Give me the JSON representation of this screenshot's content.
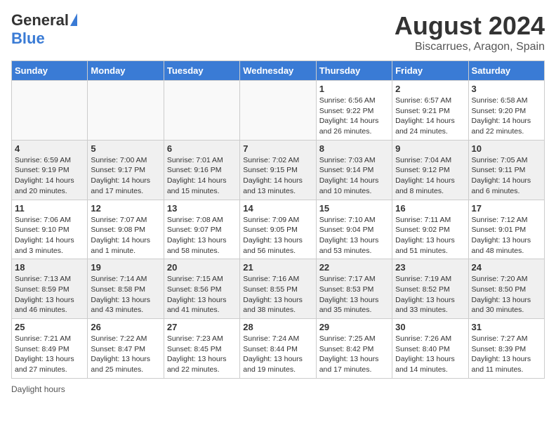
{
  "header": {
    "logo_line1": "General",
    "logo_line2": "Blue",
    "title": "August 2024",
    "subtitle": "Biscarrues, Aragon, Spain"
  },
  "calendar": {
    "days_of_week": [
      "Sunday",
      "Monday",
      "Tuesday",
      "Wednesday",
      "Thursday",
      "Friday",
      "Saturday"
    ],
    "weeks": [
      [
        {
          "day": "",
          "info": ""
        },
        {
          "day": "",
          "info": ""
        },
        {
          "day": "",
          "info": ""
        },
        {
          "day": "",
          "info": ""
        },
        {
          "day": "1",
          "info": "Sunrise: 6:56 AM\nSunset: 9:22 PM\nDaylight: 14 hours and 26 minutes."
        },
        {
          "day": "2",
          "info": "Sunrise: 6:57 AM\nSunset: 9:21 PM\nDaylight: 14 hours and 24 minutes."
        },
        {
          "day": "3",
          "info": "Sunrise: 6:58 AM\nSunset: 9:20 PM\nDaylight: 14 hours and 22 minutes."
        }
      ],
      [
        {
          "day": "4",
          "info": "Sunrise: 6:59 AM\nSunset: 9:19 PM\nDaylight: 14 hours and 20 minutes."
        },
        {
          "day": "5",
          "info": "Sunrise: 7:00 AM\nSunset: 9:17 PM\nDaylight: 14 hours and 17 minutes."
        },
        {
          "day": "6",
          "info": "Sunrise: 7:01 AM\nSunset: 9:16 PM\nDaylight: 14 hours and 15 minutes."
        },
        {
          "day": "7",
          "info": "Sunrise: 7:02 AM\nSunset: 9:15 PM\nDaylight: 14 hours and 13 minutes."
        },
        {
          "day": "8",
          "info": "Sunrise: 7:03 AM\nSunset: 9:14 PM\nDaylight: 14 hours and 10 minutes."
        },
        {
          "day": "9",
          "info": "Sunrise: 7:04 AM\nSunset: 9:12 PM\nDaylight: 14 hours and 8 minutes."
        },
        {
          "day": "10",
          "info": "Sunrise: 7:05 AM\nSunset: 9:11 PM\nDaylight: 14 hours and 6 minutes."
        }
      ],
      [
        {
          "day": "11",
          "info": "Sunrise: 7:06 AM\nSunset: 9:10 PM\nDaylight: 14 hours and 3 minutes."
        },
        {
          "day": "12",
          "info": "Sunrise: 7:07 AM\nSunset: 9:08 PM\nDaylight: 14 hours and 1 minute."
        },
        {
          "day": "13",
          "info": "Sunrise: 7:08 AM\nSunset: 9:07 PM\nDaylight: 13 hours and 58 minutes."
        },
        {
          "day": "14",
          "info": "Sunrise: 7:09 AM\nSunset: 9:05 PM\nDaylight: 13 hours and 56 minutes."
        },
        {
          "day": "15",
          "info": "Sunrise: 7:10 AM\nSunset: 9:04 PM\nDaylight: 13 hours and 53 minutes."
        },
        {
          "day": "16",
          "info": "Sunrise: 7:11 AM\nSunset: 9:02 PM\nDaylight: 13 hours and 51 minutes."
        },
        {
          "day": "17",
          "info": "Sunrise: 7:12 AM\nSunset: 9:01 PM\nDaylight: 13 hours and 48 minutes."
        }
      ],
      [
        {
          "day": "18",
          "info": "Sunrise: 7:13 AM\nSunset: 8:59 PM\nDaylight: 13 hours and 46 minutes."
        },
        {
          "day": "19",
          "info": "Sunrise: 7:14 AM\nSunset: 8:58 PM\nDaylight: 13 hours and 43 minutes."
        },
        {
          "day": "20",
          "info": "Sunrise: 7:15 AM\nSunset: 8:56 PM\nDaylight: 13 hours and 41 minutes."
        },
        {
          "day": "21",
          "info": "Sunrise: 7:16 AM\nSunset: 8:55 PM\nDaylight: 13 hours and 38 minutes."
        },
        {
          "day": "22",
          "info": "Sunrise: 7:17 AM\nSunset: 8:53 PM\nDaylight: 13 hours and 35 minutes."
        },
        {
          "day": "23",
          "info": "Sunrise: 7:19 AM\nSunset: 8:52 PM\nDaylight: 13 hours and 33 minutes."
        },
        {
          "day": "24",
          "info": "Sunrise: 7:20 AM\nSunset: 8:50 PM\nDaylight: 13 hours and 30 minutes."
        }
      ],
      [
        {
          "day": "25",
          "info": "Sunrise: 7:21 AM\nSunset: 8:49 PM\nDaylight: 13 hours and 27 minutes."
        },
        {
          "day": "26",
          "info": "Sunrise: 7:22 AM\nSunset: 8:47 PM\nDaylight: 13 hours and 25 minutes."
        },
        {
          "day": "27",
          "info": "Sunrise: 7:23 AM\nSunset: 8:45 PM\nDaylight: 13 hours and 22 minutes."
        },
        {
          "day": "28",
          "info": "Sunrise: 7:24 AM\nSunset: 8:44 PM\nDaylight: 13 hours and 19 minutes."
        },
        {
          "day": "29",
          "info": "Sunrise: 7:25 AM\nSunset: 8:42 PM\nDaylight: 13 hours and 17 minutes."
        },
        {
          "day": "30",
          "info": "Sunrise: 7:26 AM\nSunset: 8:40 PM\nDaylight: 13 hours and 14 minutes."
        },
        {
          "day": "31",
          "info": "Sunrise: 7:27 AM\nSunset: 8:39 PM\nDaylight: 13 hours and 11 minutes."
        }
      ]
    ]
  },
  "footer": {
    "daylight_label": "Daylight hours"
  }
}
